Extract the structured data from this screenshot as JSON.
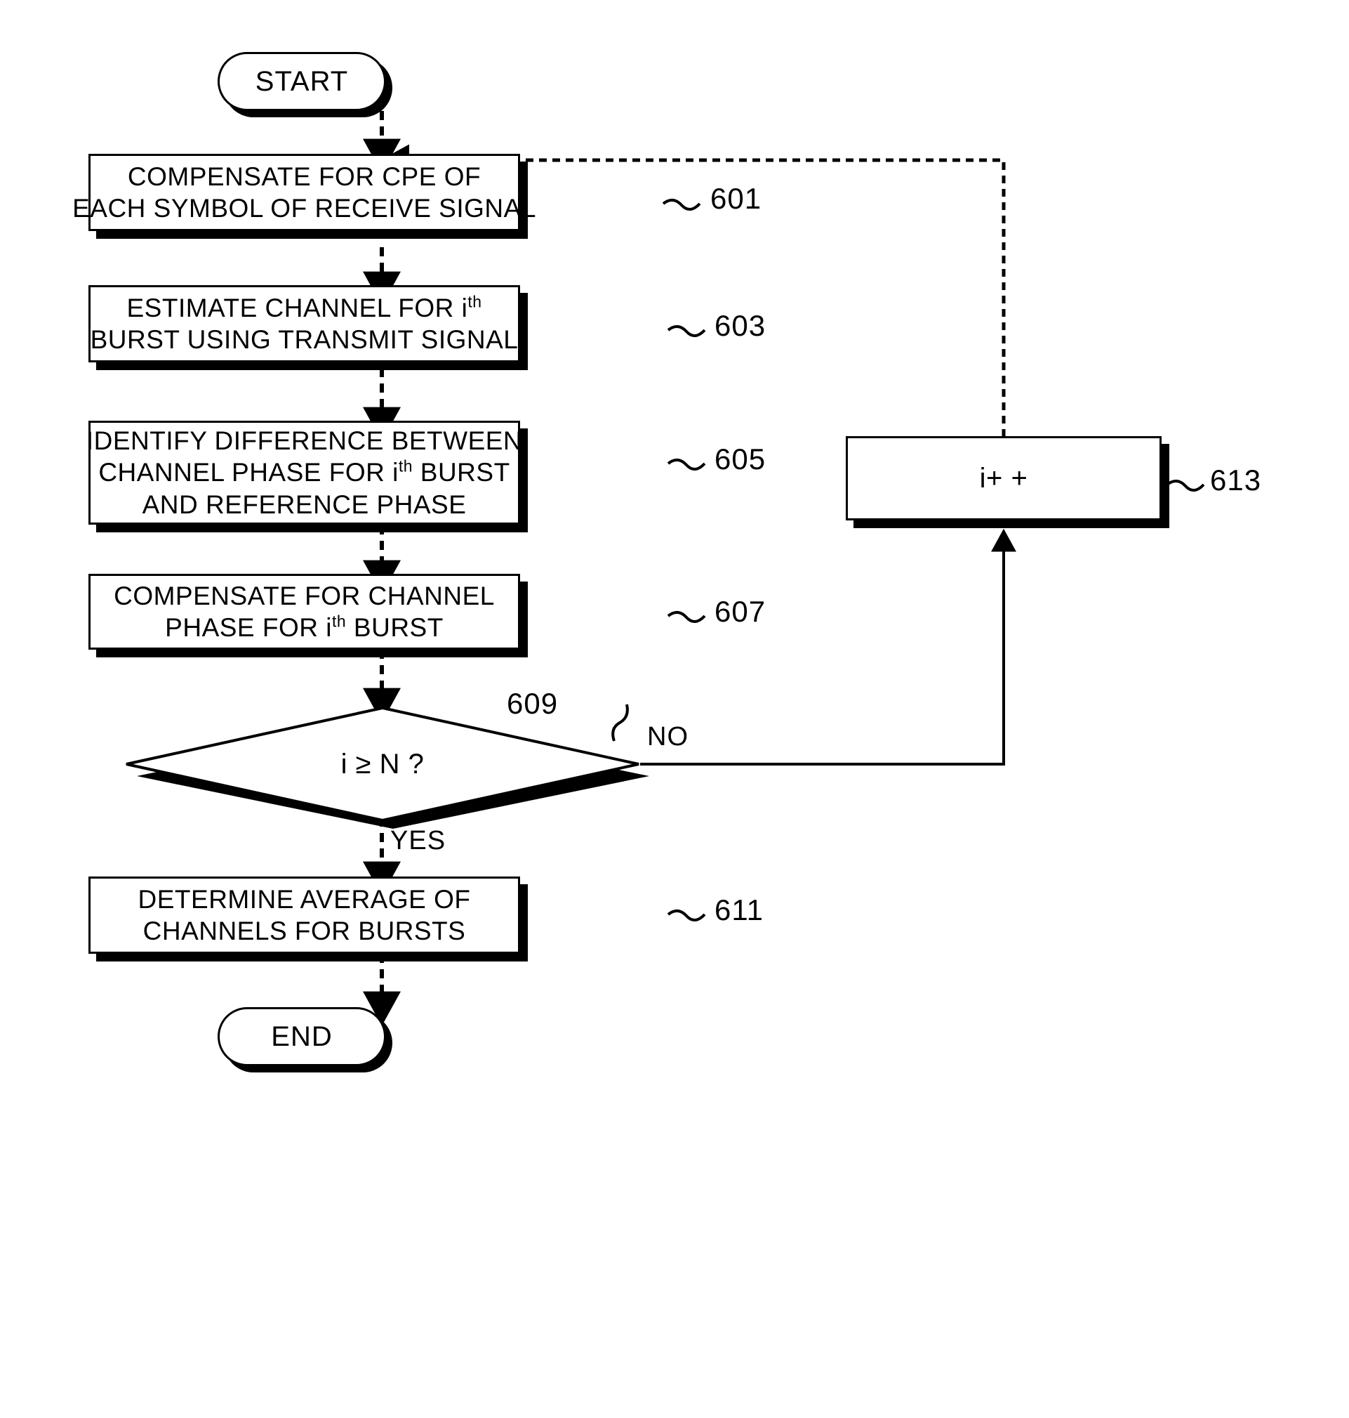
{
  "figure": {
    "type": "flowchart",
    "orientation": "vertical-with-right-loop"
  },
  "nodes": {
    "start": {
      "label": "START",
      "shape": "terminator"
    },
    "end": {
      "label": "END",
      "shape": "terminator"
    },
    "step601": {
      "ref": "601",
      "shape": "process",
      "lines": [
        "COMPENSATE FOR CPE OF",
        "EACH SYMBOL OF RECEIVE SIGNAL"
      ]
    },
    "step603": {
      "ref": "603",
      "shape": "process",
      "line1_pre": "ESTIMATE CHANNEL FOR i",
      "line1_sup": "th",
      "line1_post": "",
      "line2": "BURST USING TRANSMIT SIGNAL"
    },
    "step605": {
      "ref": "605",
      "shape": "process",
      "line1": "IDENTIFY DIFFERENCE BETWEEN",
      "line2_pre": "CHANNEL PHASE FOR i",
      "line2_sup": "th",
      "line2_post": " BURST",
      "line3": "AND REFERENCE PHASE"
    },
    "step607": {
      "ref": "607",
      "shape": "process",
      "line1": "COMPENSATE FOR CHANNEL",
      "line2_pre": "PHASE FOR i",
      "line2_sup": "th",
      "line2_post": " BURST"
    },
    "decision609": {
      "ref": "609",
      "shape": "decision",
      "label": "i ≥ N ?",
      "yes_label": "YES",
      "no_label": "NO"
    },
    "step611": {
      "ref": "611",
      "shape": "process",
      "lines": [
        "DETERMINE AVERAGE OF",
        "CHANNELS FOR BURSTS"
      ]
    },
    "step613": {
      "ref": "613",
      "shape": "process",
      "label": "i+ +"
    }
  },
  "colors": {
    "stroke": "#000000",
    "fill": "#ffffff",
    "shadow": "#000000"
  }
}
